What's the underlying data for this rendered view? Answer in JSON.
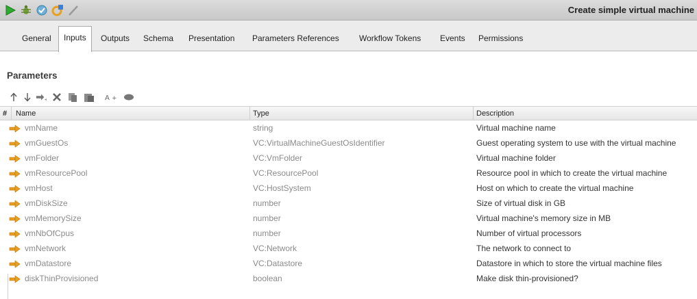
{
  "window": {
    "title": "Create simple virtual machine"
  },
  "toolbar_icons": [
    "run-icon",
    "debug-icon",
    "validate-icon",
    "refresh-icon",
    "edit-icon"
  ],
  "tabs": [
    {
      "label": "General"
    },
    {
      "label": "Inputs"
    },
    {
      "label": "Outputs"
    },
    {
      "label": "Schema"
    },
    {
      "label": "Presentation"
    },
    {
      "label": "Parameters References"
    },
    {
      "label": "Workflow Tokens"
    },
    {
      "label": "Events"
    },
    {
      "label": "Permissions"
    }
  ],
  "active_tab": "Inputs",
  "section": {
    "title": "Parameters"
  },
  "param_toolbar": [
    "move-up-icon",
    "move-down-icon",
    "add-parameter-icon",
    "delete-icon",
    "copy-icon",
    "paste-icon",
    "add-attribute-icon",
    "eye-icon"
  ],
  "table": {
    "headers": {
      "num": "#",
      "name": "Name",
      "type": "Type",
      "description": "Description"
    },
    "rows": [
      {
        "name": "vmName",
        "type": "string",
        "description": "Virtual machine name"
      },
      {
        "name": "vmGuestOs",
        "type": "VC:VirtualMachineGuestOsIdentifier",
        "description": "Guest operating system to use with the virtual machine"
      },
      {
        "name": "vmFolder",
        "type": "VC:VmFolder",
        "description": "Virtual machine folder"
      },
      {
        "name": "vmResourcePool",
        "type": "VC:ResourcePool",
        "description": "Resource pool in which to create the virtual machine"
      },
      {
        "name": "vmHost",
        "type": "VC:HostSystem",
        "description": "Host on which to create the virtual machine"
      },
      {
        "name": "vmDiskSize",
        "type": "number",
        "description": "Size of virtual disk in GB"
      },
      {
        "name": "vmMemorySize",
        "type": "number",
        "description": "Virtual machine's memory size in MB"
      },
      {
        "name": "vmNbOfCpus",
        "type": "number",
        "description": "Number of virtual processors"
      },
      {
        "name": "vmNetwork",
        "type": "VC:Network",
        "description": "The network to connect to"
      },
      {
        "name": "vmDatastore",
        "type": "VC:Datastore",
        "description": "Datastore in which to store the virtual machine files"
      },
      {
        "name": "diskThinProvisioned",
        "type": "boolean",
        "description": "Make disk thin-provisioned?"
      }
    ]
  },
  "colors": {
    "accent_orange": "#e8a020",
    "run_green": "#2eaa2e"
  }
}
